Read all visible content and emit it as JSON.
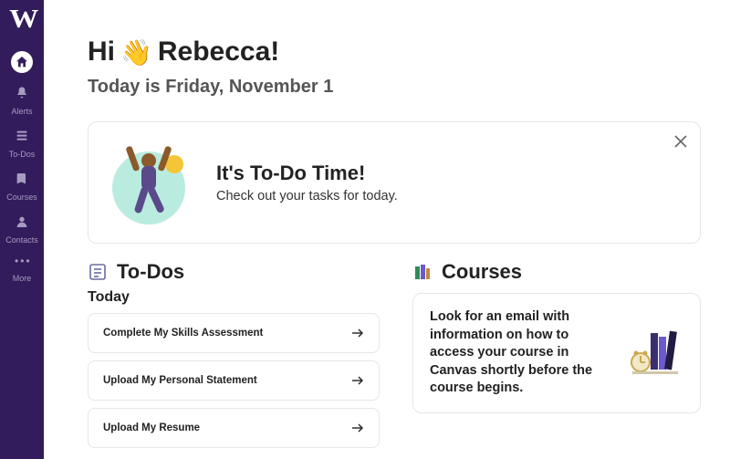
{
  "sidebar": {
    "logo": "W",
    "items": [
      {
        "id": "home",
        "label": "",
        "active": true
      },
      {
        "id": "alerts",
        "label": "Alerts"
      },
      {
        "id": "todos",
        "label": "To-Dos"
      },
      {
        "id": "courses",
        "label": "Courses"
      },
      {
        "id": "contacts",
        "label": "Contacts"
      },
      {
        "id": "more",
        "label": "More"
      }
    ]
  },
  "greeting": {
    "prefix": "Hi",
    "emoji": "👋",
    "name": "Rebecca!"
  },
  "date_line": "Today is Friday, November 1",
  "banner": {
    "title": "It's To-Do Time!",
    "subtitle": "Check out your tasks for today."
  },
  "todos": {
    "heading": "To-Dos",
    "group_label": "Today",
    "items": [
      {
        "label": "Complete My Skills Assessment"
      },
      {
        "label": "Upload My Personal Statement"
      },
      {
        "label": "Upload My Resume"
      }
    ]
  },
  "courses": {
    "heading": "Courses",
    "message": "Look for an email with information on how to access your course in Canvas shortly before the course begins."
  },
  "colors": {
    "brand": "#321c5c"
  }
}
